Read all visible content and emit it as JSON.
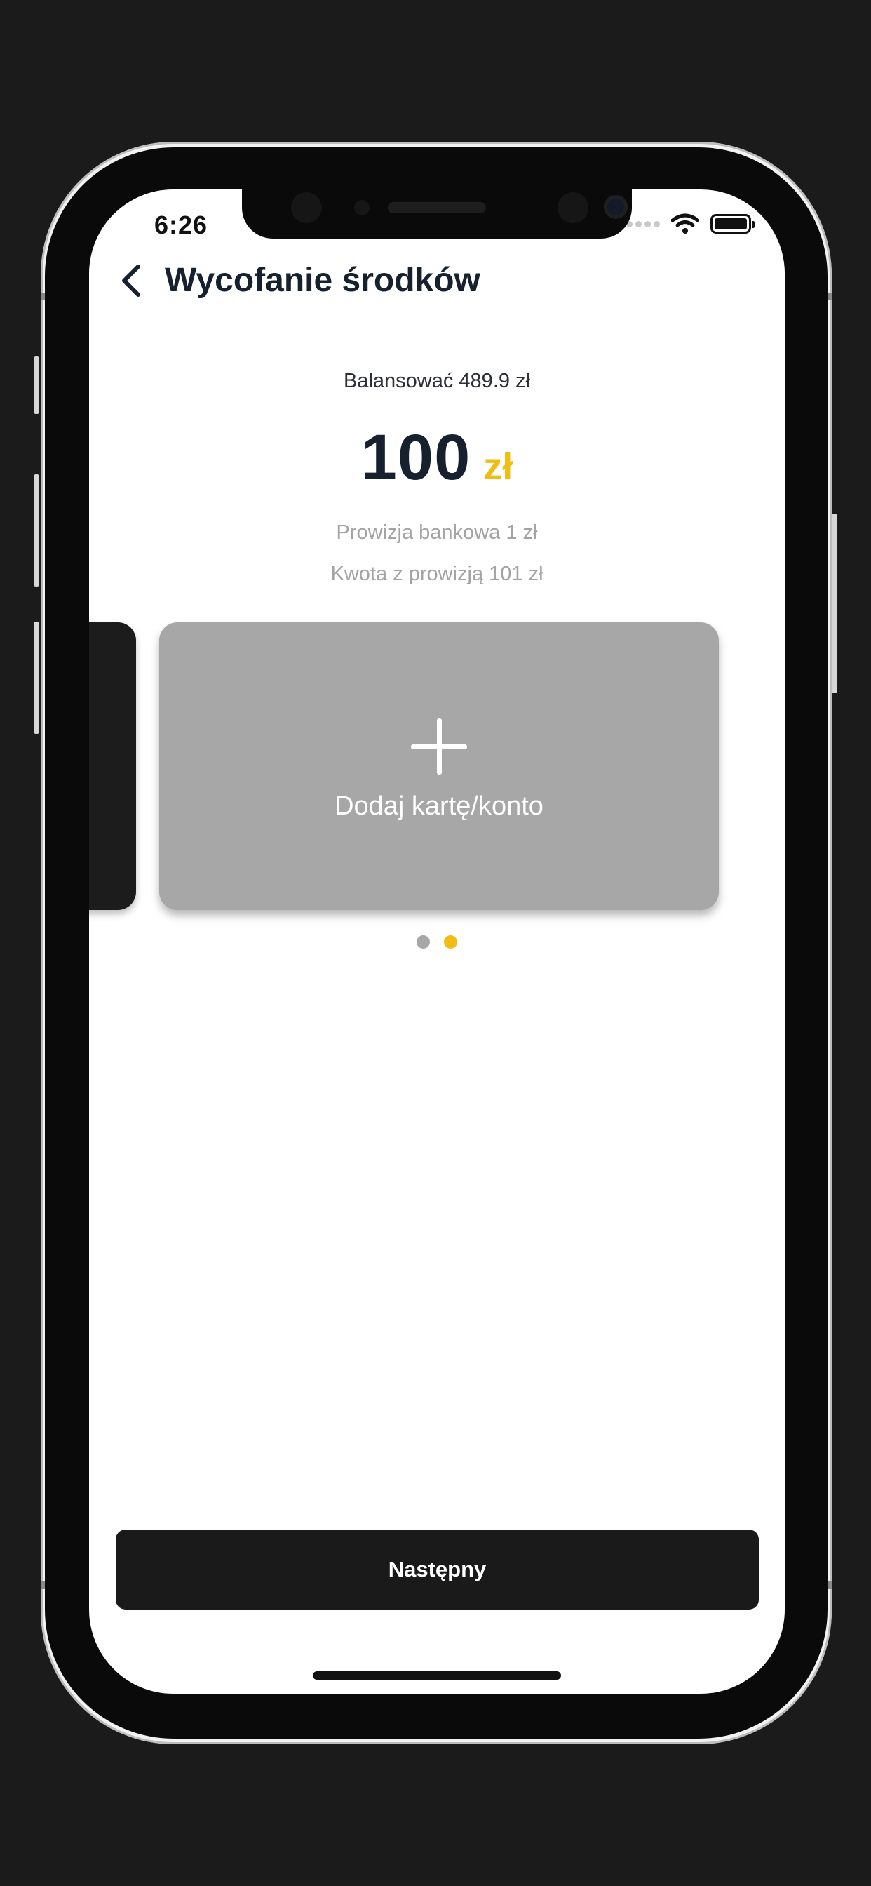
{
  "status_bar": {
    "time": "6:26"
  },
  "header": {
    "title": "Wycofanie środków",
    "back_icon": "chevron-left-icon"
  },
  "balance": {
    "text": "Balansować 489.9 zł"
  },
  "amount": {
    "value": "100",
    "currency": "zł"
  },
  "fees": {
    "bank_fee": "Prowizja bankowa 1 zł",
    "total_with_fee": "Kwota z prowizją 101 zł"
  },
  "cards": {
    "add_card_label": "Dodaj kartę/konto",
    "add_icon": "plus-icon",
    "pager": {
      "count": 2,
      "active_index": 1
    }
  },
  "footer": {
    "next_label": "Następny"
  },
  "colors": {
    "accent": "#f2bd13",
    "title": "#17202f",
    "muted": "#a3a3a3",
    "card": "#a7a7a7",
    "dot_inactive": "#a7a7a7",
    "button": "#1a1a1a"
  }
}
